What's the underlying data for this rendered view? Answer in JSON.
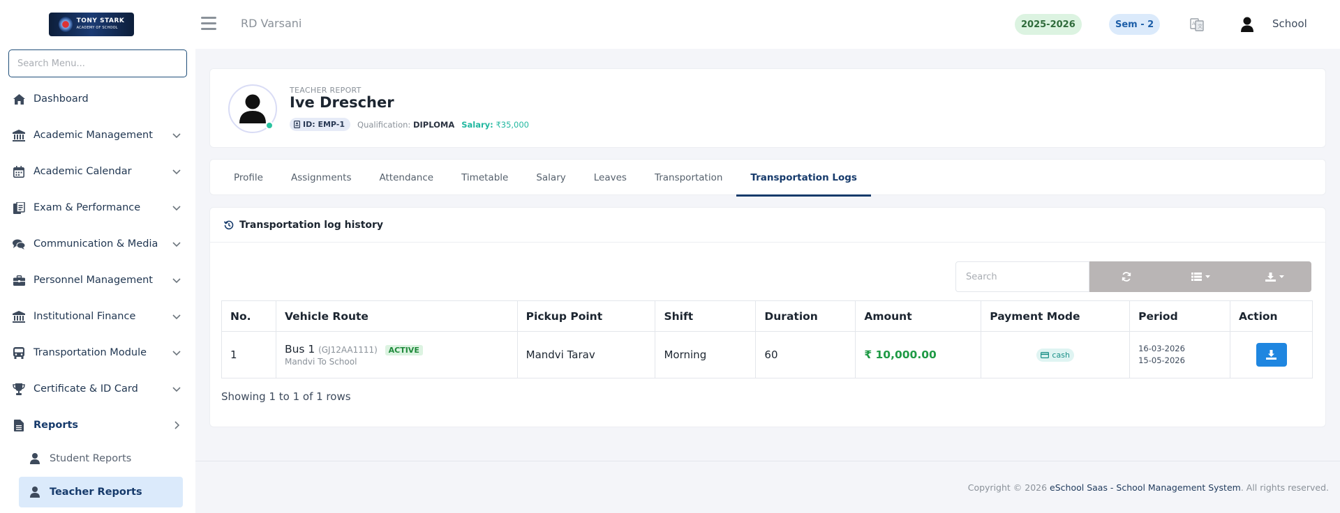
{
  "sidebar": {
    "logo_text": "TONY STARK",
    "logo_sub": "ACADEMY OF SCHOOL",
    "search_placeholder": "Search Menu...",
    "items": [
      {
        "label": "Dashboard",
        "icon": "home-icon"
      },
      {
        "label": "Academic Management",
        "icon": "bank-icon"
      },
      {
        "label": "Academic Calendar",
        "icon": "calendar-icon"
      },
      {
        "label": "Exam & Performance",
        "icon": "exam-icon"
      },
      {
        "label": "Communication & Media",
        "icon": "chat-icon"
      },
      {
        "label": "Personnel Management",
        "icon": "briefcase-icon"
      },
      {
        "label": "Institutional Finance",
        "icon": "bank-icon"
      },
      {
        "label": "Transportation Module",
        "icon": "bus-icon"
      },
      {
        "label": "Certificate & ID Card",
        "icon": "trophy-icon"
      },
      {
        "label": "Reports",
        "icon": "file-icon"
      }
    ],
    "sub_items": [
      {
        "label": "Student Reports"
      },
      {
        "label": "Teacher Reports"
      }
    ]
  },
  "topbar": {
    "org_name": "RD Varsani",
    "year_badge": "2025-2026",
    "sem_badge": "Sem - 2",
    "user_label": "School"
  },
  "profile": {
    "role": "TEACHER REPORT",
    "name": "Ive Drescher",
    "id": "ID: EMP-1",
    "qualification_label": "Qualification:",
    "qualification": "DIPLOMA",
    "salary_label": "Salary:",
    "salary": "₹35,000"
  },
  "tabs": [
    "Profile",
    "Assignments",
    "Attendance",
    "Timetable",
    "Salary",
    "Leaves",
    "Transportation",
    "Transportation Logs"
  ],
  "active_tab": "Transportation Logs",
  "logs": {
    "title": "Transportation log history",
    "search_placeholder": "Search",
    "columns": [
      "No.",
      "Vehicle Route",
      "Pickup Point",
      "Shift",
      "Duration",
      "Amount",
      "Payment Mode",
      "Period",
      "Action"
    ],
    "rows": [
      {
        "no": "1",
        "vehicle": "Bus 1",
        "vehicle_code": "(GJ12AA1111)",
        "status": "ACTIVE",
        "route": "Mandvi To School",
        "pickup": "Mandvi Tarav",
        "shift": "Morning",
        "duration": "60",
        "amount": "₹ 10,000.00",
        "payment_mode": "cash",
        "period_start": "16-03-2026",
        "period_end": "15-05-2026"
      }
    ],
    "rows_info": "Showing 1 to 1 of 1 rows"
  },
  "footer": {
    "prefix": "Copyright © 2026 ",
    "brand": "eSchool Saas - School Management System",
    "suffix": ". All rights reserved."
  },
  "colors": {
    "primary": "#163a6b",
    "accent_green": "#1f9a45",
    "teal": "#22b8a0",
    "download_btn": "#1f86e0",
    "toolbar": "#b9b5b5"
  }
}
